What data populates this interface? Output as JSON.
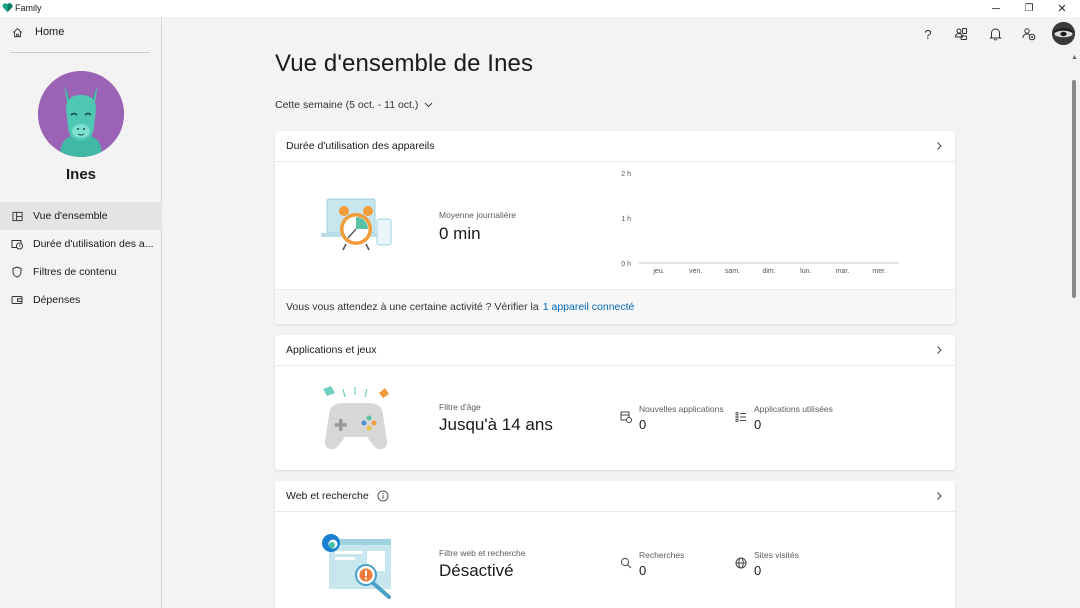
{
  "window": {
    "title": "Family",
    "controls": {
      "minimize": "─",
      "restore": "❐",
      "close": "✕"
    }
  },
  "sidebar": {
    "home_label": "Home",
    "user_name": "Ines",
    "items": [
      {
        "label": "Vue d'ensemble",
        "icon": "overview-icon",
        "active": true
      },
      {
        "label": "Durée d'utilisation des a...",
        "icon": "screen-time-icon",
        "active": false
      },
      {
        "label": "Filtres de contenu",
        "icon": "shield-icon",
        "active": false
      },
      {
        "label": "Dépenses",
        "icon": "wallet-icon",
        "active": false
      }
    ]
  },
  "topbar": {
    "icons": [
      "help-icon",
      "family-link-icon",
      "notifications-icon",
      "manage-account-icon"
    ],
    "help_glyph": "?"
  },
  "main": {
    "title": "Vue d'ensemble de Ines",
    "week_selector": "Cette semaine (5 oct. - 11 oct.)"
  },
  "cards": {
    "screen_time": {
      "title": "Durée d'utilisation des appareils",
      "metric_label": "Moyenne journalière",
      "metric_value": "0 min",
      "footer_text": "Vous vous attendez à une certaine activité ? Vérifier la",
      "footer_link": "1 appareil connecté"
    },
    "apps_games": {
      "title": "Applications et jeux",
      "metric_label": "Filtre d'âge",
      "metric_value": "Jusqu'à 14 ans",
      "new_apps_label": "Nouvelles applications",
      "new_apps_value": "0",
      "used_apps_label": "Applications utilisées",
      "used_apps_value": "0"
    },
    "web_search": {
      "title": "Web et recherche",
      "metric_label": "Filtre web et recherche",
      "metric_value": "Désactivé",
      "searches_label": "Recherches",
      "searches_value": "0",
      "sites_label": "Sites visités",
      "sites_value": "0"
    }
  },
  "colors": {
    "accent": "#0067b8",
    "avatar_bg": "#9a63b6",
    "llama": "#4ec7b3",
    "chart_baseline": "#c8c8c8"
  },
  "chart_data": {
    "type": "bar",
    "categories": [
      "jeu.",
      "ven.",
      "sam.",
      "dim.",
      "lun.",
      "mar.",
      "mer."
    ],
    "values": [
      0,
      0,
      0,
      0,
      0,
      0,
      0
    ],
    "y_tick_labels": [
      "0 h",
      "1 h",
      "2 h"
    ],
    "y_unit": "h",
    "ylim": [
      0,
      2
    ],
    "grid": false,
    "title": "",
    "xlabel": "",
    "ylabel": ""
  }
}
